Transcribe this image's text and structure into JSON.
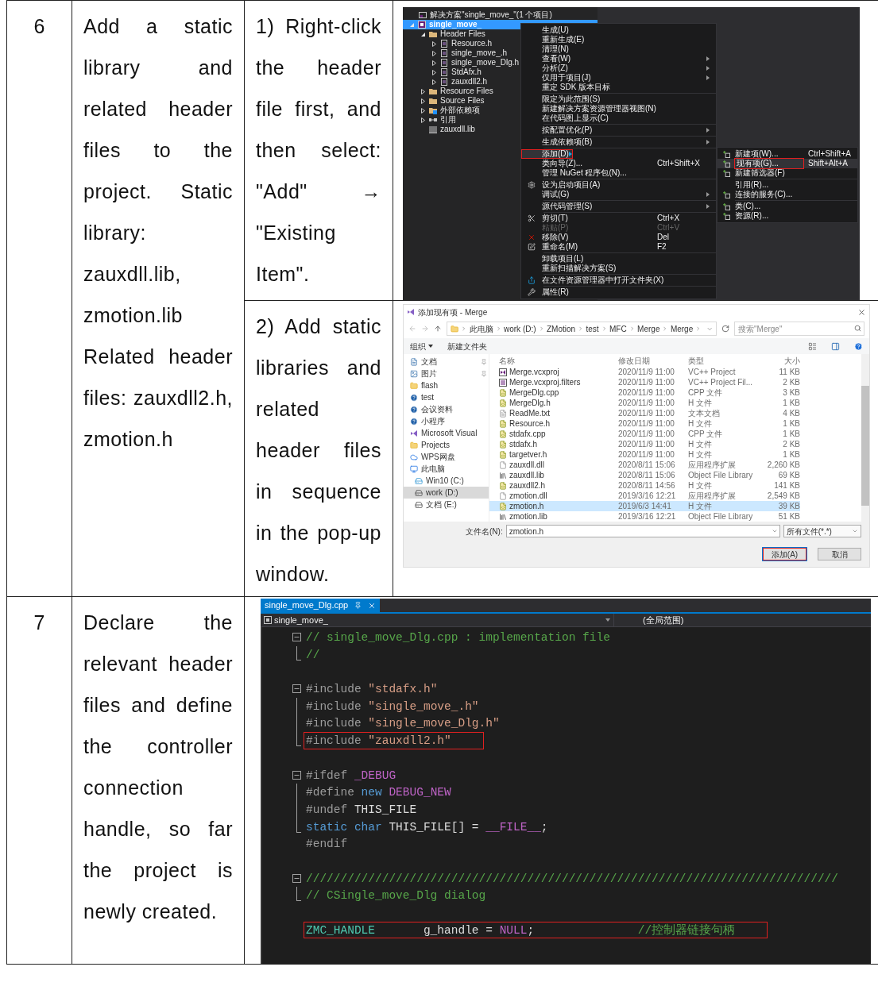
{
  "table": {
    "rows": [
      {
        "number": "6",
        "description": [
          "Add a static library and related header files to the project. Static library: zauxdll.lib, zmotion.lib",
          "Related header files: zauxdll2.h, zmotion.h"
        ],
        "parts": [
          {
            "text": "1) Right-click the header file first, and then select: \"Add\" → \"Existing Item\".",
            "screenshot": {
              "kind": "ide_menu",
              "explorer_title": "解决方案\"single_move_\"(1 个项目)",
              "tree": [
                {
                  "label": "single_move_",
                  "kind": "project",
                  "selected": true,
                  "expanded": true,
                  "children": [
                    {
                      "label": "Header Files",
                      "kind": "filter",
                      "selected": false,
                      "expanded": true,
                      "children": [
                        {
                          "label": "Resource.h",
                          "kind": "file",
                          "selected": false,
                          "expanded": false
                        },
                        {
                          "label": "single_move_.h",
                          "kind": "file",
                          "selected": false,
                          "expanded": false
                        },
                        {
                          "label": "single_move_Dlg.h",
                          "kind": "file",
                          "selected": false,
                          "expanded": false
                        },
                        {
                          "label": "StdAfx.h",
                          "kind": "file",
                          "selected": false,
                          "expanded": false
                        },
                        {
                          "label": "zauxdll2.h",
                          "kind": "file",
                          "selected": false,
                          "expanded": false
                        }
                      ]
                    },
                    {
                      "label": "Resource Files",
                      "kind": "filter",
                      "selected": false,
                      "expanded": false
                    },
                    {
                      "label": "Source Files",
                      "kind": "filter",
                      "selected": false,
                      "expanded": false
                    },
                    {
                      "label": "外部依赖项",
                      "kind": "external",
                      "selected": false,
                      "expanded": false
                    },
                    {
                      "label": "引用",
                      "kind": "references",
                      "selected": false,
                      "expanded": false
                    },
                    {
                      "label": "zauxdll.lib",
                      "kind": "library",
                      "selected": false
                    }
                  ]
                }
              ],
              "menu": [
                [
                  {
                    "label": "生成(U)",
                    "submenu": false,
                    "disabled": false,
                    "selected": false
                  },
                  {
                    "label": "重新生成(E)",
                    "submenu": false,
                    "disabled": false,
                    "selected": false
                  },
                  {
                    "label": "清理(N)",
                    "submenu": false,
                    "disabled": false,
                    "selected": false
                  },
                  {
                    "label": "查看(W)",
                    "submenu": true,
                    "disabled": false,
                    "selected": false
                  },
                  {
                    "label": "分析(Z)",
                    "submenu": true,
                    "disabled": false,
                    "selected": false
                  },
                  {
                    "label": "仅用于项目(J)",
                    "submenu": true,
                    "disabled": false,
                    "selected": false
                  },
                  {
                    "label": "重定 SDK 版本目标",
                    "submenu": false,
                    "disabled": false,
                    "selected": false
                  }
                ],
                [
                  {
                    "label": "限定为此范围(S)",
                    "submenu": false,
                    "disabled": false,
                    "selected": false
                  },
                  {
                    "label": "新建解决方案资源管理器视图(N)",
                    "submenu": false,
                    "disabled": false,
                    "selected": false
                  },
                  {
                    "label": "在代码图上显示(C)",
                    "submenu": false,
                    "disabled": false,
                    "selected": false
                  }
                ],
                [
                  {
                    "label": "按配置优化(P)",
                    "submenu": true,
                    "disabled": false,
                    "selected": false
                  }
                ],
                [
                  {
                    "label": "生成依赖项(B)",
                    "submenu": true,
                    "disabled": false,
                    "selected": false
                  }
                ],
                [
                  {
                    "label": "添加(D)",
                    "submenu": true,
                    "disabled": false,
                    "selected": true
                  },
                  {
                    "label": "类向导(Z)...",
                    "shortcut": "Ctrl+Shift+X",
                    "submenu": false,
                    "disabled": false,
                    "selected": false
                  },
                  {
                    "label": "管理 NuGet 程序包(N)...",
                    "submenu": false,
                    "disabled": false,
                    "selected": false
                  }
                ],
                [
                  {
                    "label": "设为启动项目(A)",
                    "submenu": false,
                    "disabled": false,
                    "selected": false
                  },
                  {
                    "label": "调试(G)",
                    "submenu": true,
                    "disabled": false,
                    "selected": false
                  }
                ],
                [
                  {
                    "label": "源代码管理(S)",
                    "submenu": true,
                    "disabled": false,
                    "selected": false
                  }
                ],
                [
                  {
                    "label": "剪切(T)",
                    "shortcut": "Ctrl+X",
                    "submenu": false,
                    "disabled": false,
                    "selected": false
                  },
                  {
                    "label": "粘贴(P)",
                    "shortcut": "Ctrl+V",
                    "submenu": false,
                    "disabled": true,
                    "selected": false
                  },
                  {
                    "label": "移除(V)",
                    "shortcut": "Del",
                    "submenu": false,
                    "disabled": false,
                    "selected": false
                  },
                  {
                    "label": "重命名(M)",
                    "shortcut": "F2",
                    "submenu": false,
                    "disabled": false,
                    "selected": false
                  }
                ],
                [
                  {
                    "label": "卸载项目(L)",
                    "submenu": false,
                    "disabled": false,
                    "selected": false
                  },
                  {
                    "label": "重新扫描解决方案(S)",
                    "submenu": false,
                    "disabled": false,
                    "selected": false
                  }
                ],
                [
                  {
                    "label": "在文件资源管理器中打开文件夹(X)",
                    "submenu": false,
                    "disabled": false,
                    "selected": false
                  }
                ],
                [
                  {
                    "label": "属性(R)",
                    "submenu": false,
                    "disabled": false,
                    "selected": false
                  }
                ]
              ],
              "submenu": [
                [
                  {
                    "label": "新建项(W)...",
                    "shortcut": "Ctrl+Shift+A",
                    "selected": false
                  },
                  {
                    "label": "现有项(G)...",
                    "shortcut": "Shift+Alt+A",
                    "selected": true
                  },
                  {
                    "label": "新建筛选器(F)",
                    "selected": false
                  }
                ],
                [
                  {
                    "label": "引用(R)...",
                    "selected": false
                  },
                  {
                    "label": "连接的服务(C)...",
                    "selected": false
                  }
                ],
                [
                  {
                    "label": "类(C)...",
                    "selected": false
                  },
                  {
                    "label": "资源(R)...",
                    "selected": false
                  }
                ]
              ]
            }
          },
          {
            "text": "2) Add static libraries and related header files in sequence in the pop-up window.",
            "screenshot": {
              "kind": "file_dialog",
              "title": "添加现有项 - Merge",
              "path": [
                "此电脑",
                "work (D:)",
                "ZMotion",
                "test",
                "MFC",
                "Merge",
                "Merge"
              ],
              "search_placeholder": "搜索\"Merge\"",
              "toolbar": [
                "组织",
                "新建文件夹"
              ],
              "nav": [
                {
                  "label": "文档",
                  "kind": "documents",
                  "pinned": true,
                  "selected": false
                },
                {
                  "label": "图片",
                  "kind": "pictures",
                  "pinned": true,
                  "selected": false
                },
                {
                  "label": "flash",
                  "kind": "folder",
                  "pinned": false,
                  "selected": false
                },
                {
                  "label": "test",
                  "kind": "synced",
                  "pinned": false,
                  "selected": false
                },
                {
                  "label": "会议资料",
                  "kind": "synced",
                  "pinned": false,
                  "selected": false
                },
                {
                  "label": "小程序",
                  "kind": "synced",
                  "pinned": false,
                  "selected": false
                },
                {
                  "label": "Microsoft Visual",
                  "kind": "vs",
                  "pinned": false,
                  "selected": false
                },
                {
                  "label": "Projects",
                  "kind": "folder",
                  "pinned": false,
                  "selected": false
                },
                {
                  "label": "WPS网盘",
                  "kind": "cloud",
                  "pinned": false,
                  "selected": false
                },
                {
                  "label": "此电脑",
                  "kind": "pc",
                  "pinned": false,
                  "selected": false,
                  "children": [
                    {
                      "label": "Win10 (C:)",
                      "kind": "system_drive",
                      "pinned": false,
                      "selected": false
                    },
                    {
                      "label": "work (D:)",
                      "kind": "drive",
                      "pinned": false,
                      "selected": true
                    },
                    {
                      "label": "文档 (E:)",
                      "kind": "drive",
                      "pinned": false,
                      "selected": false
                    }
                  ]
                }
              ],
              "columns": [
                "名称",
                "修改日期",
                "类型",
                "大小"
              ],
              "files": [
                {
                  "name": "Merge.vcxproj",
                  "date": "2020/11/9 11:00",
                  "type": "VC++ Project",
                  "size": "11 KB",
                  "kind": "project",
                  "selected": false
                },
                {
                  "name": "Merge.vcxproj.filters",
                  "date": "2020/11/9 11:00",
                  "type": "VC++ Project Fil...",
                  "size": "2 KB",
                  "kind": "filters",
                  "selected": false
                },
                {
                  "name": "MergeDlg.cpp",
                  "date": "2020/11/9 11:00",
                  "type": "CPP 文件",
                  "size": "3 KB",
                  "kind": "code",
                  "selected": false
                },
                {
                  "name": "MergeDlg.h",
                  "date": "2020/11/9 11:00",
                  "type": "H 文件",
                  "size": "1 KB",
                  "kind": "code",
                  "selected": false
                },
                {
                  "name": "ReadMe.txt",
                  "date": "2020/11/9 11:00",
                  "type": "文本文档",
                  "size": "4 KB",
                  "kind": "text",
                  "selected": false
                },
                {
                  "name": "Resource.h",
                  "date": "2020/11/9 11:00",
                  "type": "H 文件",
                  "size": "1 KB",
                  "kind": "code",
                  "selected": false
                },
                {
                  "name": "stdafx.cpp",
                  "date": "2020/11/9 11:00",
                  "type": "CPP 文件",
                  "size": "1 KB",
                  "kind": "code",
                  "selected": false
                },
                {
                  "name": "stdafx.h",
                  "date": "2020/11/9 11:00",
                  "type": "H 文件",
                  "size": "2 KB",
                  "kind": "code",
                  "selected": false
                },
                {
                  "name": "targetver.h",
                  "date": "2020/11/9 11:00",
                  "type": "H 文件",
                  "size": "1 KB",
                  "kind": "code",
                  "selected": false
                },
                {
                  "name": "zauxdll.dll",
                  "date": "2020/8/11 15:06",
                  "type": "应用程序扩展",
                  "size": "2,260 KB",
                  "kind": "dll",
                  "selected": false
                },
                {
                  "name": "zauxdll.lib",
                  "date": "2020/8/11 15:06",
                  "type": "Object File Library",
                  "size": "69 KB",
                  "kind": "lib",
                  "selected": false
                },
                {
                  "name": "zauxdll2.h",
                  "date": "2020/8/11 14:56",
                  "type": "H 文件",
                  "size": "141 KB",
                  "kind": "code",
                  "selected": false
                },
                {
                  "name": "zmotion.dll",
                  "date": "2019/3/16 12:21",
                  "type": "应用程序扩展",
                  "size": "2,549 KB",
                  "kind": "dll",
                  "selected": false
                },
                {
                  "name": "zmotion.h",
                  "date": "2019/6/3 14:41",
                  "type": "H 文件",
                  "size": "39 KB",
                  "kind": "code",
                  "selected": true
                },
                {
                  "name": "zmotion.lib",
                  "date": "2019/3/16 12:21",
                  "type": "Object File Library",
                  "size": "51 KB",
                  "kind": "lib",
                  "selected": false
                }
              ],
              "filename_label": "文件名(N):",
              "filename": "zmotion.h",
              "filter": "所有文件(*.*)",
              "buttons": [
                {
                  "label": "添加(A)",
                  "selected": true
                },
                {
                  "label": "取消",
                  "selected": false
                }
              ]
            }
          }
        ]
      },
      {
        "number": "7",
        "description": [
          "Declare the relevant header files and define the controller connection handle, so far the project is newly created."
        ],
        "parts": [
          {
            "screenshot": {
              "kind": "code_editor",
              "tab": "single_move_Dlg.cpp",
              "nav_project": "single_move_",
              "nav_scope": "(全局范围)",
              "lines": [
                {
                  "kind": "block_start",
                  "boxed": false,
                  "tokens": [
                    {
                      "text": "// single_move_Dlg.cpp : implementation file",
                      "kind": "comment"
                    }
                  ]
                },
                {
                  "kind": "block_end",
                  "boxed": false,
                  "tokens": [
                    {
                      "text": "//",
                      "kind": "comment"
                    }
                  ]
                },
                {
                  "kind": "plain"
                },
                {
                  "kind": "block_start",
                  "boxed": false,
                  "tokens": [
                    {
                      "text": "#include ",
                      "kind": "directive"
                    },
                    {
                      "text": "\"stdafx.h\"",
                      "kind": "string"
                    }
                  ]
                },
                {
                  "kind": "block_inner",
                  "boxed": false,
                  "tokens": [
                    {
                      "text": "#include ",
                      "kind": "directive"
                    },
                    {
                      "text": "\"single_move_.h\"",
                      "kind": "string"
                    }
                  ]
                },
                {
                  "kind": "block_inner",
                  "boxed": false,
                  "tokens": [
                    {
                      "text": "#include ",
                      "kind": "directive"
                    },
                    {
                      "text": "\"single_move_Dlg.h\"",
                      "kind": "string"
                    }
                  ]
                },
                {
                  "kind": "block_end",
                  "boxed": true,
                  "tokens": [
                    {
                      "text": "#include ",
                      "kind": "directive"
                    },
                    {
                      "text": "\"zauxdll2.h\"",
                      "kind": "string"
                    }
                  ]
                },
                {
                  "kind": "plain"
                },
                {
                  "kind": "block_start",
                  "boxed": false,
                  "tokens": [
                    {
                      "text": "#ifdef ",
                      "kind": "directive"
                    },
                    {
                      "text": "_DEBUG",
                      "kind": "macro"
                    }
                  ]
                },
                {
                  "kind": "block_inner",
                  "boxed": false,
                  "tokens": [
                    {
                      "text": "#define ",
                      "kind": "directive"
                    },
                    {
                      "text": "new ",
                      "kind": "keyword"
                    },
                    {
                      "text": "DEBUG_NEW",
                      "kind": "macro"
                    }
                  ]
                },
                {
                  "kind": "block_inner",
                  "boxed": false,
                  "tokens": [
                    {
                      "text": "#undef ",
                      "kind": "directive"
                    },
                    {
                      "text": "THIS_FILE",
                      "kind": "plain"
                    }
                  ]
                },
                {
                  "kind": "block_end",
                  "boxed": false,
                  "tokens": [
                    {
                      "text": "static char ",
                      "kind": "keyword"
                    },
                    {
                      "text": "THIS_FILE[] = ",
                      "kind": "plain"
                    },
                    {
                      "text": "__FILE__",
                      "kind": "macro"
                    },
                    {
                      "text": ";",
                      "kind": "plain"
                    }
                  ]
                },
                {
                  "kind": "plain",
                  "boxed": false,
                  "tokens": [
                    {
                      "text": "#endif",
                      "kind": "directive"
                    }
                  ]
                },
                {
                  "kind": "plain"
                },
                {
                  "kind": "block_start",
                  "boxed": false,
                  "tokens": [
                    {
                      "text": "/////////////////////////////////////////////////////////////////////////////",
                      "kind": "comment"
                    }
                  ]
                },
                {
                  "kind": "block_end",
                  "boxed": false,
                  "tokens": [
                    {
                      "text": "// CSingle_move_Dlg dialog",
                      "kind": "comment"
                    }
                  ]
                },
                {
                  "kind": "plain"
                },
                {
                  "kind": "plain",
                  "boxed": true,
                  "tokens": [
                    {
                      "text": "ZMC_HANDLE       ",
                      "kind": "type"
                    },
                    {
                      "text": "g_handle = ",
                      "kind": "plain"
                    },
                    {
                      "text": "NULL",
                      "kind": "macro"
                    },
                    {
                      "text": ";               ",
                      "kind": "plain"
                    },
                    {
                      "text": "//控制器链接句柄",
                      "kind": "comment"
                    }
                  ]
                }
              ]
            }
          }
        ]
      }
    ]
  }
}
